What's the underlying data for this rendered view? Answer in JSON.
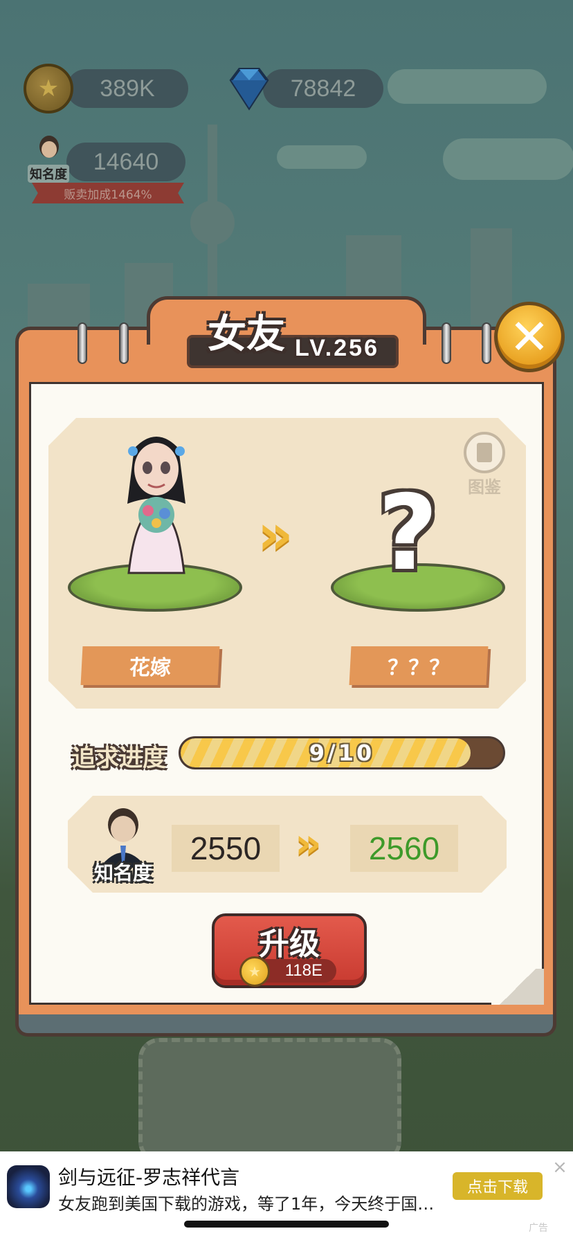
{
  "hud": {
    "coins": "389K",
    "gems": "78842",
    "fame": "14640",
    "fame_tag": "知名度",
    "sales_bonus": "贩卖加成1464%"
  },
  "dialog": {
    "title": "女友",
    "level": "LV.256",
    "atlas_label": "图鉴",
    "current_name": "花嫁",
    "next_name": "？？？",
    "progress_label": "追求进度",
    "progress_text": "9/10",
    "progress_value": 0.9,
    "fame_label": "知名度",
    "fame_current": "2550",
    "fame_next": "2560",
    "upgrade_label": "升级",
    "upgrade_cost": "118E"
  },
  "ad": {
    "title": "剑与远征-罗志祥代言",
    "description": "女友跑到美国下载的游戏，等了1年，今天终于国内...",
    "button": "点击下载",
    "tag": "广告"
  },
  "colors": {
    "accent_orange": "#e8925a",
    "next_value_green": "#3e9a2a",
    "upgrade_red": "#d8463a",
    "ad_button": "#d8b52a"
  }
}
